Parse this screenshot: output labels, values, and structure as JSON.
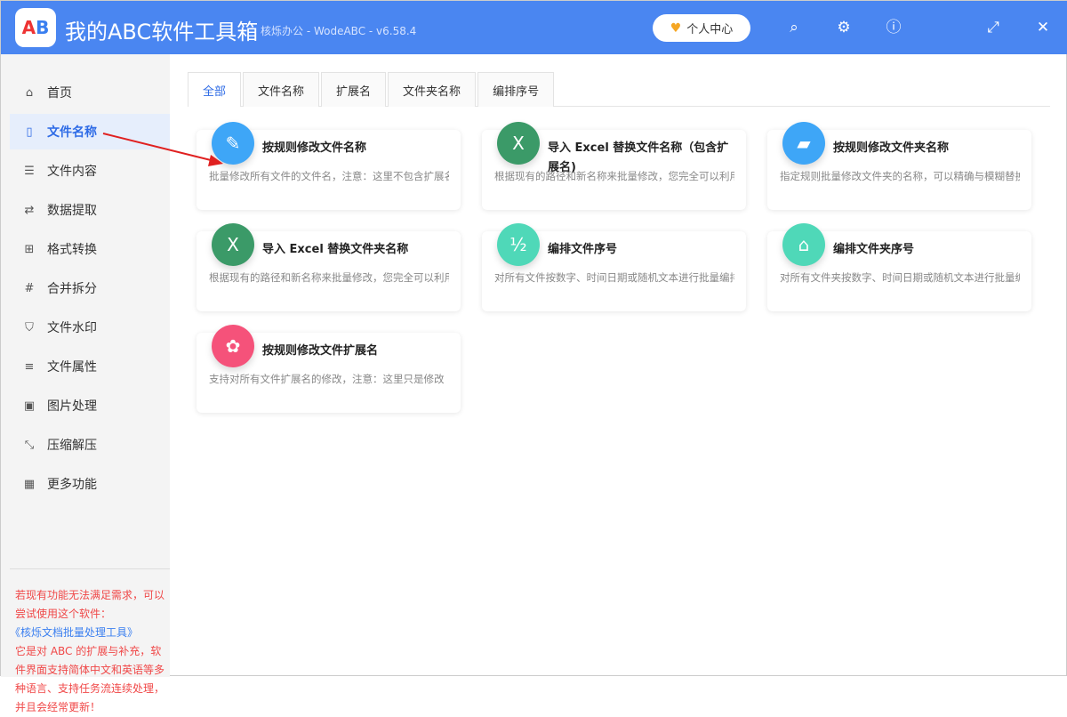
{
  "app": {
    "logo_text": "AB",
    "title": "我的ABC软件工具箱",
    "subtitle": "核烁办公 - WodeABC - v6.58.4",
    "user_center": "个人中心"
  },
  "sidebar": {
    "items": [
      {
        "label": "首页",
        "icon": "home-icon"
      },
      {
        "label": "文件名称",
        "icon": "file-icon"
      },
      {
        "label": "文件内容",
        "icon": "list-icon"
      },
      {
        "label": "数据提取",
        "icon": "extract-icon"
      },
      {
        "label": "格式转换",
        "icon": "convert-icon"
      },
      {
        "label": "合并拆分",
        "icon": "hash-icon"
      },
      {
        "label": "文件水印",
        "icon": "shield-icon"
      },
      {
        "label": "文件属性",
        "icon": "properties-icon"
      },
      {
        "label": "图片处理",
        "icon": "image-icon"
      },
      {
        "label": "压缩解压",
        "icon": "compress-icon"
      },
      {
        "label": "更多功能",
        "icon": "grid-icon"
      }
    ],
    "active": 1,
    "promo": {
      "line1": "若现有功能无法满足需求，可以尝试使用这个软件：",
      "link": "《核烁文档批量处理工具》",
      "line2": "它是对 ABC 的扩展与补充，软件界面支持简体中文和英语等多种语言、支持任务流连续处理，并且会经常更新！"
    }
  },
  "tabs": [
    "全部",
    "文件名称",
    "扩展名",
    "文件夹名称",
    "编排序号"
  ],
  "cards": [
    {
      "title": "按规则修改文件名称",
      "desc": "批量修改所有文件的文件名，注意：这里不包含扩展名",
      "color": "#3ea6f7"
    },
    {
      "title": "导入 Excel 替换文件名称（包含扩展名)",
      "desc": "根据现有的路径和新名称来批量修改，您完全可以利用",
      "color": "#3b9a68"
    },
    {
      "title": "按规则修改文件夹名称",
      "desc": "指定规则批量修改文件夹的名称，可以精确与模糊替换",
      "color": "#3ea6f7"
    },
    {
      "title": "导入 Excel 替换文件夹名称",
      "desc": "根据现有的路径和新名称来批量修改，您完全可以利用",
      "color": "#3b9a68"
    },
    {
      "title": "编排文件序号",
      "desc": "对所有文件按数字、时间日期或随机文本进行批量编排",
      "color": "#4fd8b8"
    },
    {
      "title": "编排文件夹序号",
      "desc": "对所有文件夹按数字、时间日期或随机文本进行批量编排",
      "color": "#4fd8b8"
    },
    {
      "title": "按规则修改文件扩展名",
      "desc": "支持对所有文件扩展名的修改，注意：这里只是修改",
      "color": "#f5527a"
    }
  ]
}
